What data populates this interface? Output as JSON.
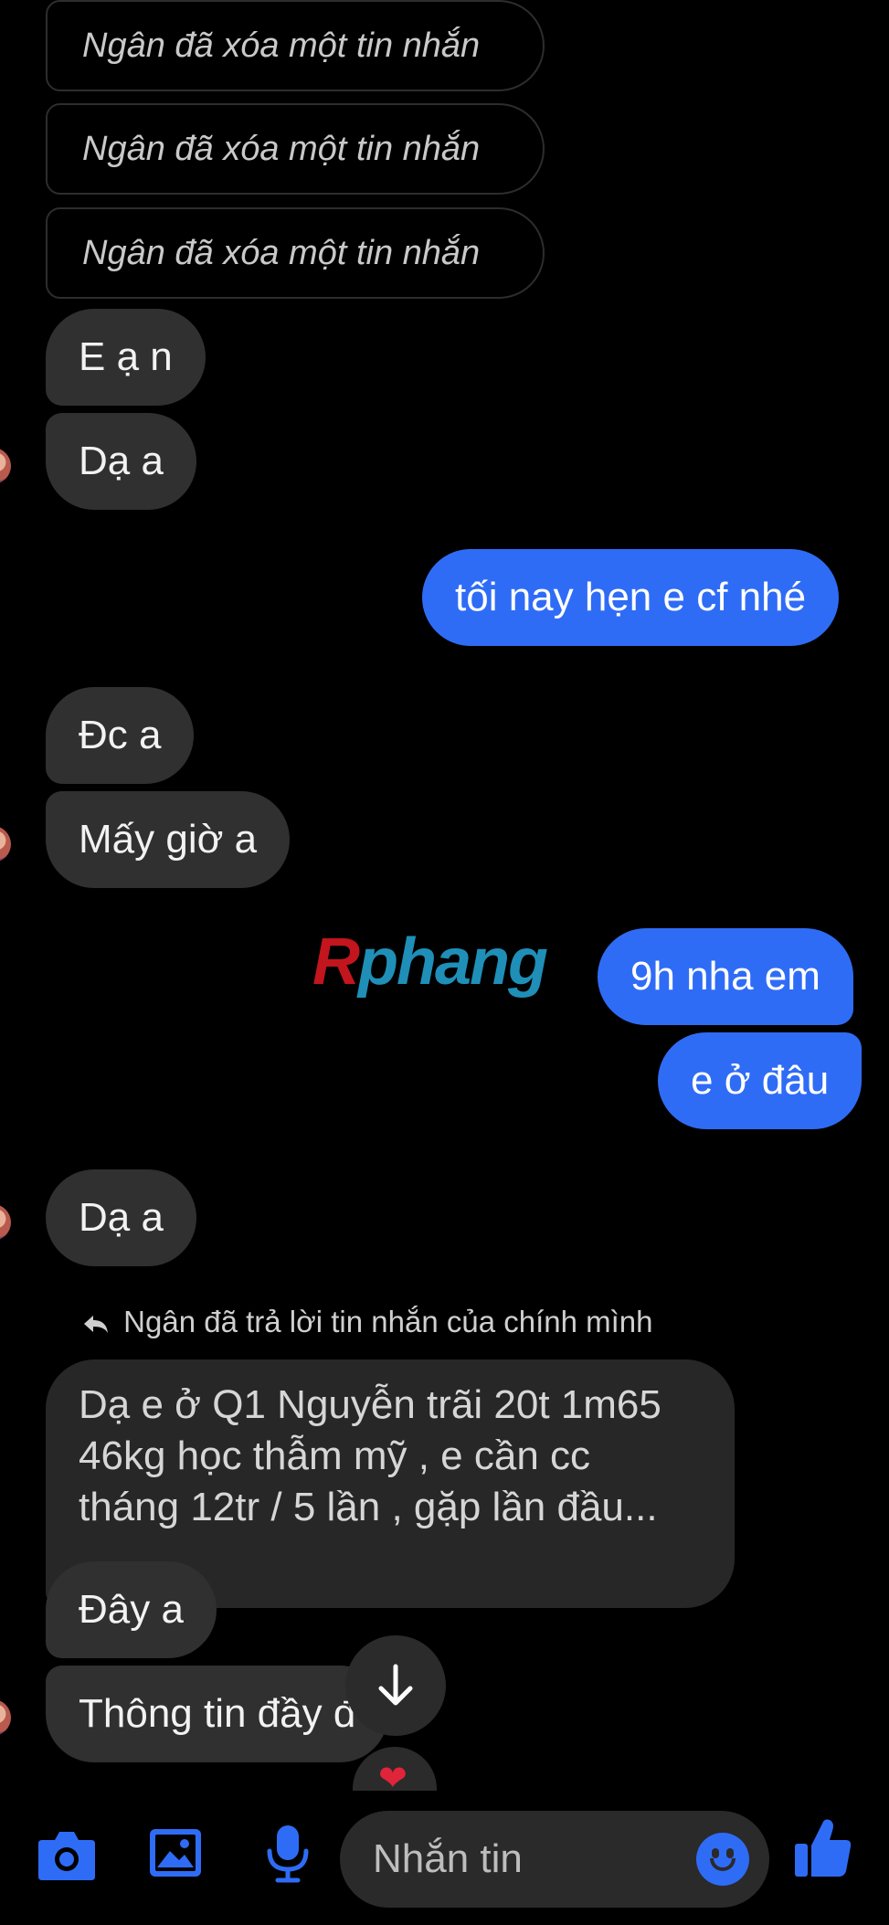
{
  "thread": {
    "deleted_messages": [
      "Ngân đã xóa một tin nhắn",
      "Ngân đã xóa một tin nhắn",
      "Ngân đã xóa một tin nhắn"
    ],
    "messages": {
      "m1": "E ạ n",
      "m2": "Dạ a",
      "m3": "tối nay hẹn e cf nhé",
      "m4": "Đc a",
      "m5": "Mấy giờ a",
      "m6": "9h nha em",
      "m7": "e ở đâu",
      "m8": "Dạ a",
      "reply_note": "Ngân đã trả lời tin nhắn của chính mình",
      "replied_lines": [
        "Dạ e ở Q1 Nguyễn trãi 20t 1m65",
        "46kg học thẫm mỹ , e cần cc",
        "tháng 12tr / 5 lần , gặp lần đầu..."
      ],
      "m9": "Đây a",
      "m10": "Thông tin đầy đ"
    },
    "reaction": "❤"
  },
  "watermark": {
    "first": "R",
    "rest": "phang"
  },
  "composer": {
    "placeholder": "Nhắn tin",
    "icons": [
      "camera-icon",
      "image-icon",
      "microphone-icon",
      "emoji-icon",
      "thumbs-up-icon"
    ],
    "accent": "#2f6cf6"
  },
  "colors": {
    "outgoing_bubble": "#2f6cf6",
    "incoming_bubble": "#303030",
    "background": "#000000"
  }
}
